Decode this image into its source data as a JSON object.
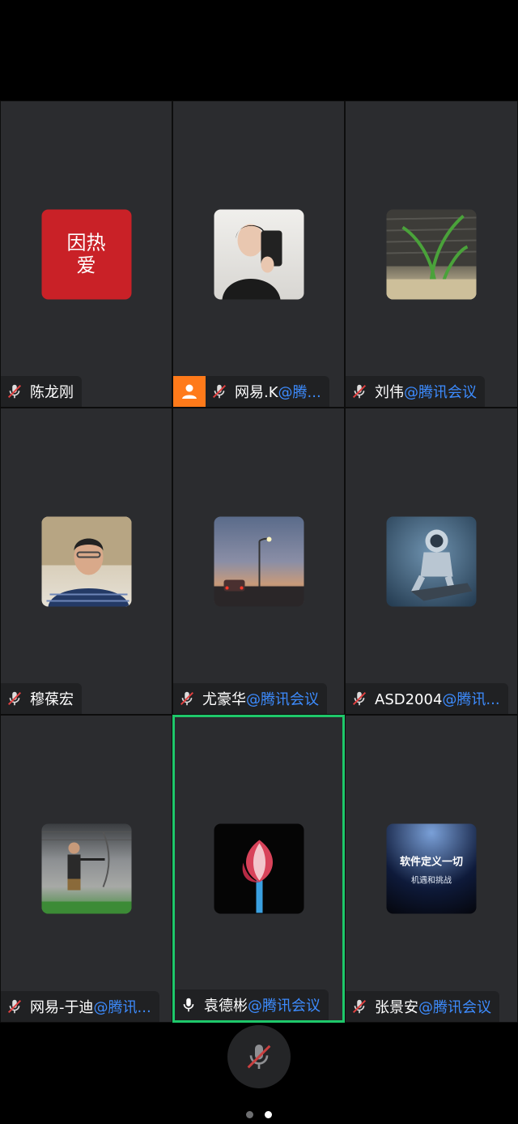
{
  "participants": [
    {
      "name": "陈龙刚",
      "suffix": "",
      "muted": true,
      "avatar": "red-calligraphy-avatar"
    },
    {
      "name": "网易.K",
      "suffix": "@腾...",
      "muted": true,
      "host": true,
      "avatar": "woman-selfie-avatar"
    },
    {
      "name": "刘伟",
      "suffix": "@腾讯会议",
      "muted": true,
      "avatar": "aquarium-plant-avatar"
    },
    {
      "name": "穆葆宏",
      "suffix": "",
      "muted": true,
      "avatar": "man-portrait-avatar"
    },
    {
      "name": "尤豪华",
      "suffix": "@腾讯会议",
      "muted": true,
      "avatar": "street-lamp-dusk-avatar"
    },
    {
      "name": "ASD2004",
      "suffix": "@腾讯...",
      "muted": true,
      "avatar": "astronaut-avatar"
    },
    {
      "name": "网易-于迪",
      "suffix": "@腾讯...",
      "muted": true,
      "avatar": "archer-avatar"
    },
    {
      "name": "袁德彬",
      "suffix": "@腾讯会议",
      "muted": false,
      "active": true,
      "avatar": "tulip-avatar"
    },
    {
      "name": "张景安",
      "suffix": "@腾讯会议",
      "muted": true,
      "avatar": "stage-slide-avatar"
    }
  ],
  "avatar_texts": {
    "calligraphy": "因热爱",
    "slide_line1": "软件定义一切",
    "slide_line2": "机遇和挑战"
  },
  "controls": {
    "mic_muted": true,
    "mic_icon": "mic-muted-icon"
  },
  "pager": {
    "pages": 2,
    "current": 2
  },
  "colors": {
    "active_border": "#1ec86a",
    "suffix": "#3d8cff",
    "host_badge": "#ff7a1a",
    "tile_bg": "#2b2c2f"
  }
}
